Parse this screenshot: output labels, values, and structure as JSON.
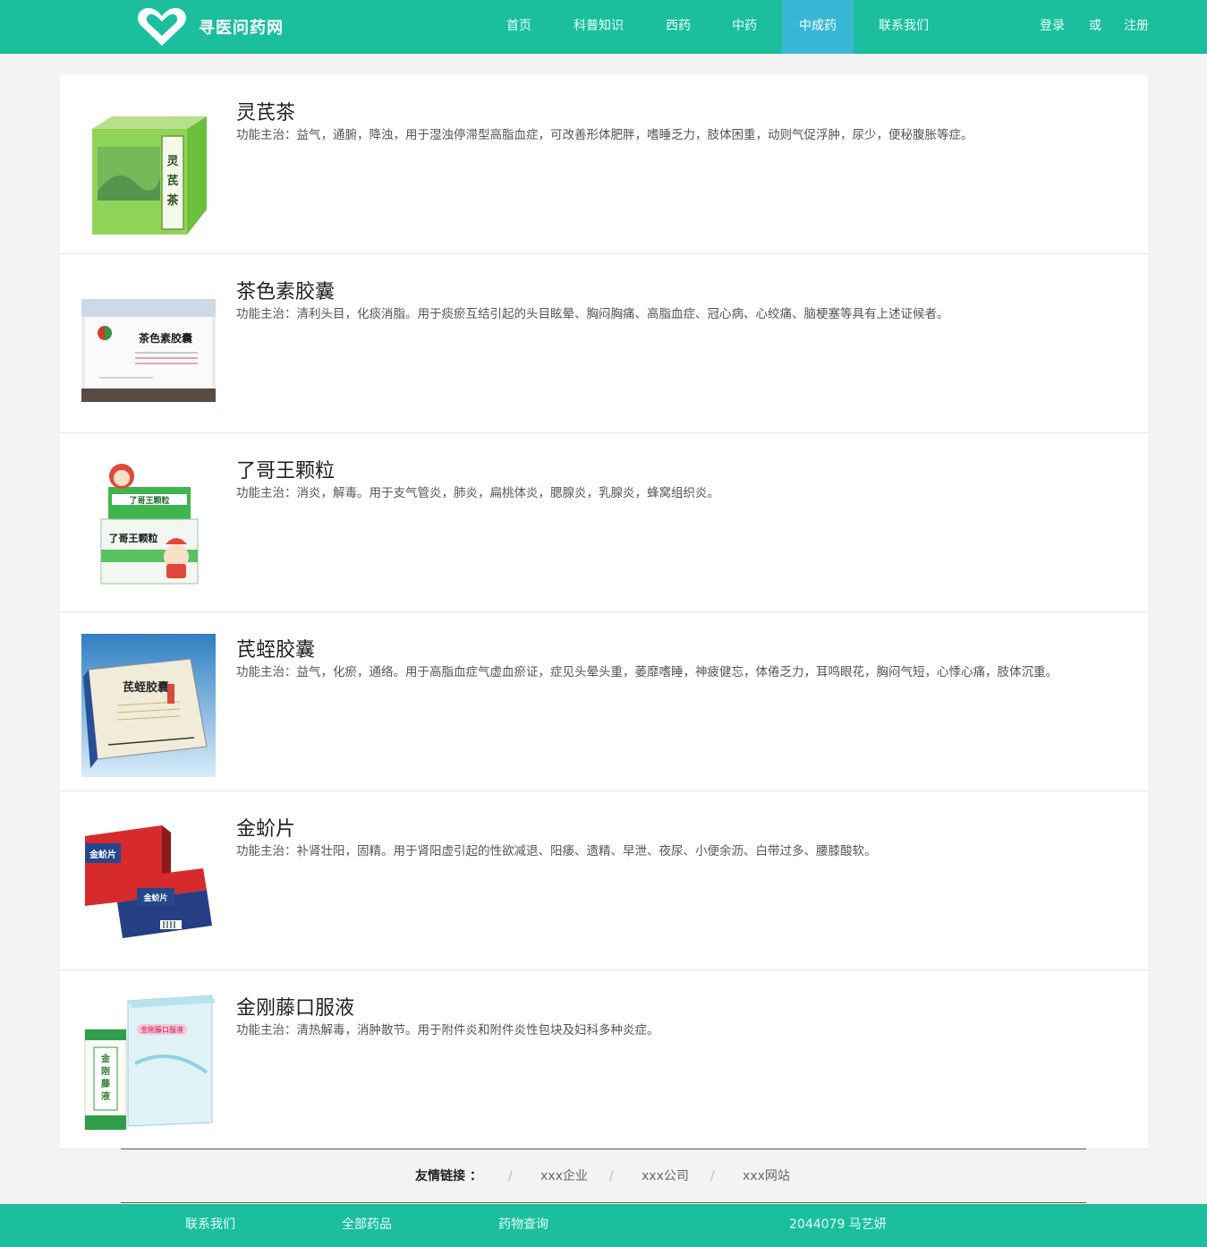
{
  "header": {
    "site_name": "寻医问药网",
    "nav": [
      "首页",
      "科普知识",
      "西药",
      "中药",
      "中成药",
      "联系我们"
    ],
    "active_nav": "中成药",
    "login": "登录",
    "or": "或",
    "register": "注册"
  },
  "medicines": [
    {
      "name": "灵芪茶",
      "desc": "功能主治：益气，通腑，降浊，用于湿浊停滞型高脂血症，可改善形体肥胖，嗜睡乏力，肢体困重，动则气促浮肿，尿少，便秘腹胀等症。",
      "box_label": "灵芪茶"
    },
    {
      "name": "茶色素胶囊",
      "desc": "功能主治：清利头目，化痰消脂。用于痰瘀互结引起的头目眩晕、胸闷胸痛、高脂血症、冠心病、心绞痛、脑梗塞等具有上述证候者。",
      "box_label": "茶色素胶囊"
    },
    {
      "name": "了哥王颗粒",
      "desc": "功能主治：消炎，解毒。用于支气管炎，肺炎，扁桃体炎，腮腺炎，乳腺炎，蜂窝组织炎。",
      "box_label": "了哥王颗粒"
    },
    {
      "name": "芪蛭胶囊",
      "desc": "功能主治：益气，化瘀，通络。用于高脂血症气虚血瘀证，症见头晕头重，萎靡嗜睡，神疲健忘，体倦乏力，耳鸣眼花，胸闷气短，心悸心痛，肢体沉重。",
      "box_label": "芪蛭胶囊"
    },
    {
      "name": "金蚧片",
      "desc": "功能主治：补肾壮阳，固精。用于肾阳虚引起的性欲减退、阳痿、遗精、早泄、夜尿、小便余沥、白带过多、腰膝酸软。",
      "box_label": "金蚧片"
    },
    {
      "name": "金刚藤口服液",
      "desc": "功能主治：清热解毒，消肿散节。用于附件炎和附件炎性包块及妇科多种炎症。",
      "box_label": "金刚藤口服液"
    }
  ],
  "friend_links": {
    "title": "友情链接 ：",
    "sep": "/",
    "links": [
      "xxx企业",
      "xxx公司",
      "xxx网站"
    ]
  },
  "footer": {
    "items": [
      "联系我们",
      "全部药品",
      "药物查询"
    ],
    "credit": "2044079 马艺妍"
  },
  "colors": {
    "brand": "#1bbf9d",
    "nav_active": "#38b8d4"
  }
}
